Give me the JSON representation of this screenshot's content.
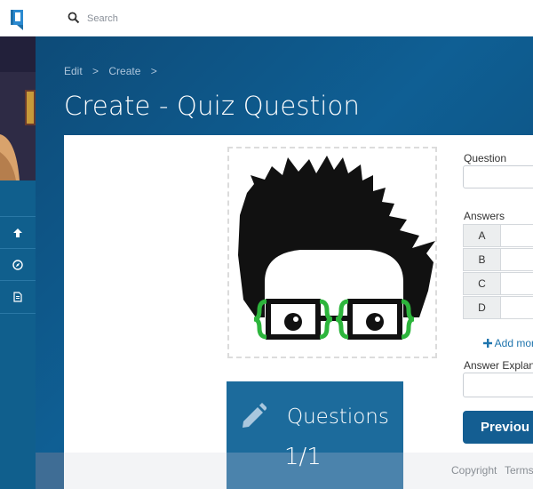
{
  "search": {
    "placeholder": "Search"
  },
  "breadcrumb": [
    "Edit",
    ">",
    "Create",
    ">"
  ],
  "page_title": "Create - Quiz Question",
  "questions_card": {
    "label": "Questions",
    "count": "1/1"
  },
  "form": {
    "question_label": "Question",
    "answers_label": "Answers",
    "answers": [
      {
        "letter": "A",
        "value": ""
      },
      {
        "letter": "B",
        "value": ""
      },
      {
        "letter": "C",
        "value": ""
      },
      {
        "letter": "D",
        "value": ""
      }
    ],
    "add_more_label": "Add mor",
    "explanation_label": "Answer Explana",
    "previous_button": "Previou"
  },
  "footer": {
    "copyright": "Copyright",
    "terms": "Terms"
  },
  "colors": {
    "brand": "#105f8d",
    "accent": "#1e74ad",
    "glasses": "#2db53c"
  },
  "icons": [
    "logo-icon",
    "search-icon",
    "arrow-up-icon",
    "compass-icon",
    "document-icon",
    "pencil-icon",
    "plus-icon"
  ]
}
